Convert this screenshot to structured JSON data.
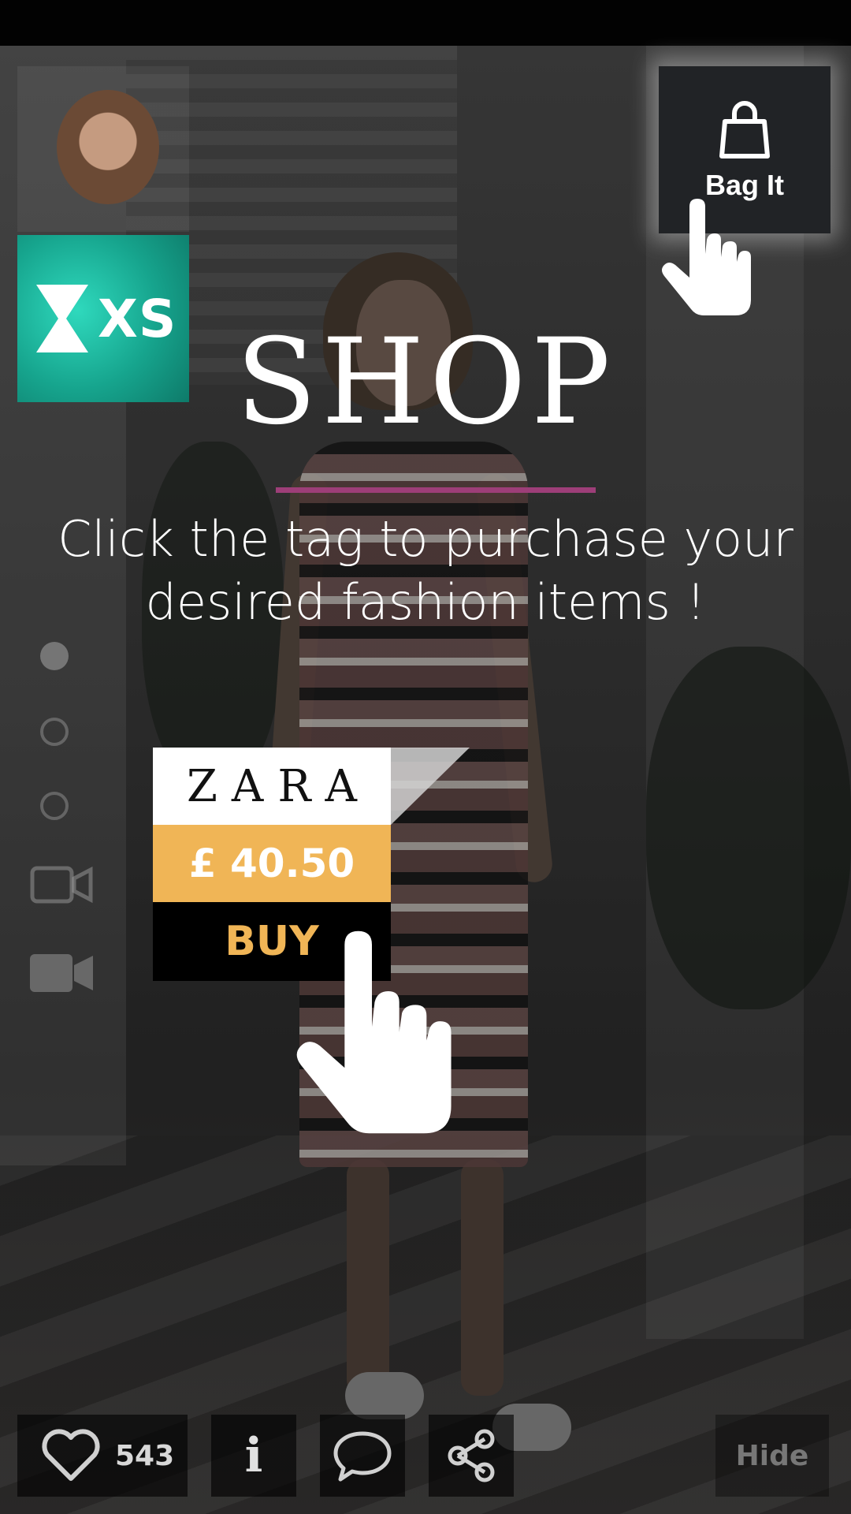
{
  "overlay": {
    "title": "SHOP",
    "subtitle": "Click the tag to purchase your desired fashion items !"
  },
  "badge": {
    "label": "XS",
    "color": "#1fbfa3"
  },
  "bag_it": {
    "label": "Bag It"
  },
  "product_tag": {
    "brand": "ZARA",
    "price": "£ 40.50",
    "buy_label": "BUY",
    "price_color": "#f0b556"
  },
  "actions": {
    "likes": "543",
    "info_label": "i",
    "hide_label": "Hide"
  },
  "icons": [
    "avatar",
    "hourglass-icon",
    "shopping-bag-icon",
    "pointing-hand-icon",
    "heart-icon",
    "comment-icon",
    "share-icon",
    "video-camera-icon"
  ],
  "colors": {
    "accent_underline": "#9d3e78",
    "teal": "#1fbfa3"
  }
}
